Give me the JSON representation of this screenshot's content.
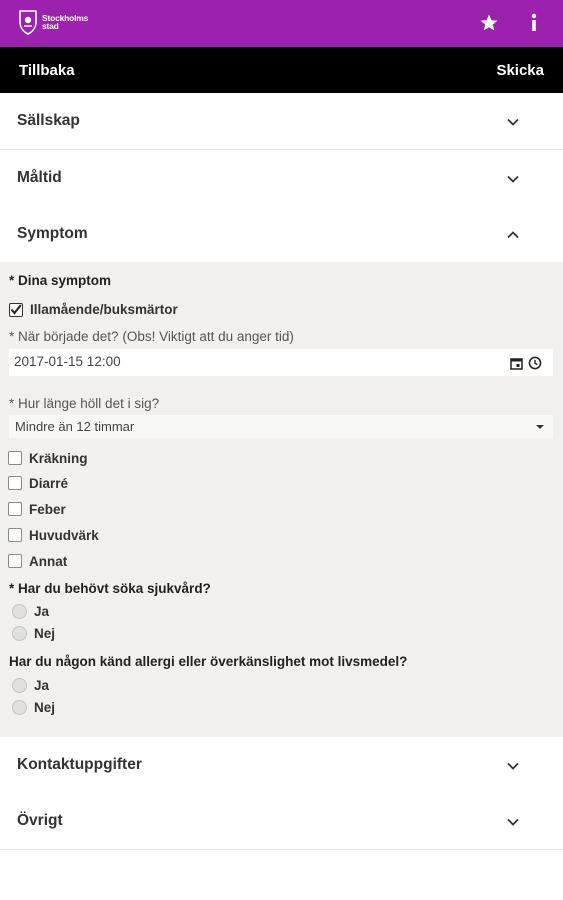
{
  "app": {
    "logo_line1": "Stockholms",
    "logo_line2": "stad",
    "brand_color": "#9b22ad",
    "icons": [
      "star-icon",
      "info-icon"
    ]
  },
  "nav": {
    "back_label": "Tillbaka",
    "send_label": "Skicka"
  },
  "sections": {
    "company": "Sällskap",
    "meal": "Måltid",
    "symptoms": "Symptom",
    "contact": "Kontaktuppgifter",
    "other": "Övrigt"
  },
  "symptoms": {
    "your_symptoms_label": "* Dina symptom",
    "nausea_label": "Illamående/buksmärtor",
    "nausea_checked": true,
    "when_label": "* När började det? (Obs! Viktigt att du anger tid)",
    "when_value": "2017-01-15 12:00",
    "duration_label": "* Hur länge höll det i sig?",
    "duration_value": "Mindre än 12 timmar",
    "other_symptoms": [
      {
        "label": "Kräkning",
        "checked": false
      },
      {
        "label": "Diarré",
        "checked": false
      },
      {
        "label": "Feber",
        "checked": false
      },
      {
        "label": "Huvudvärk",
        "checked": false
      },
      {
        "label": "Annat",
        "checked": false
      }
    ],
    "care_question": "* Har du behövt söka sjukvård?",
    "care_yes": "Ja",
    "care_no": "Nej",
    "allergy_question": "Har du någon känd allergi eller överkänslighet mot livsmedel?",
    "allergy_yes": "Ja",
    "allergy_no": "Nej"
  }
}
